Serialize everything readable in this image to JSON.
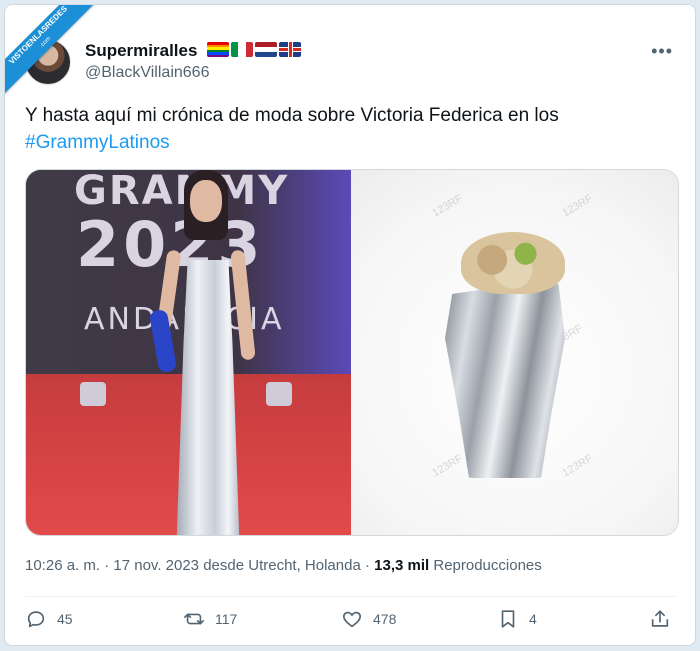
{
  "watermark": {
    "line1": "VISTOENLASREDES",
    "line2": ".com"
  },
  "author": {
    "name": "Supermiralles",
    "handle": "@BlackVillain666",
    "flag_icons": [
      "rainbow-flag-icon",
      "italy-flag-icon",
      "netherlands-flag-icon",
      "uk-flag-icon"
    ]
  },
  "tweet": {
    "text": "Y hasta aquí mi crónica de moda sobre Victoria Federica en los",
    "hashtag": "#GrammyLatinos"
  },
  "media": {
    "left_photo_text": {
      "line1": "GRAMMY",
      "line2": "2023",
      "line3": "ANDALUCIA"
    },
    "right_photo_watermark": "123RF"
  },
  "meta": {
    "time": "10:26 a. m.",
    "sep1": " · ",
    "date": "17 nov. 2023",
    "location": " desde Utrecht, Holanda",
    "sep2": " · ",
    "views_count": "13,3 mil",
    "views_label": " Reproducciones"
  },
  "actions": {
    "replies": "45",
    "retweets": "117",
    "likes": "478",
    "bookmarks": "4"
  },
  "colors": {
    "accent": "#1d9bf0",
    "text": "#0f1419",
    "muted": "#536471",
    "ribbon": "#1d8fd6"
  }
}
